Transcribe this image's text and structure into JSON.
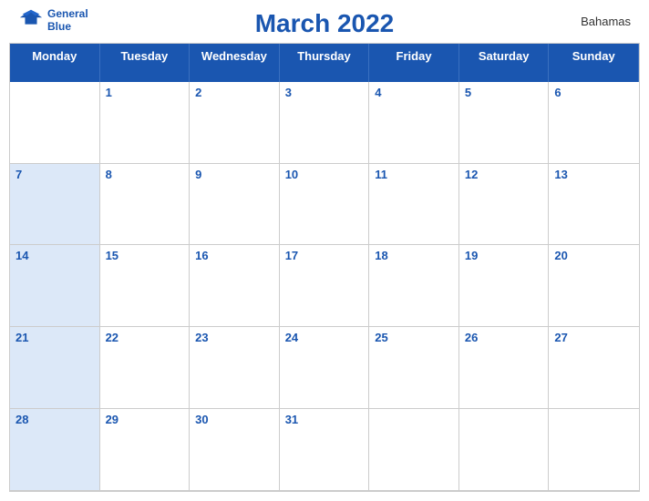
{
  "header": {
    "logo": {
      "line1": "General",
      "line2": "Blue"
    },
    "title": "March 2022",
    "country": "Bahamas"
  },
  "calendar": {
    "days_of_week": [
      "Monday",
      "Tuesday",
      "Wednesday",
      "Thursday",
      "Friday",
      "Saturday",
      "Sunday"
    ],
    "weeks": [
      [
        {
          "num": "",
          "empty": true
        },
        {
          "num": "1"
        },
        {
          "num": "2"
        },
        {
          "num": "3"
        },
        {
          "num": "4"
        },
        {
          "num": "5"
        },
        {
          "num": "6"
        }
      ],
      [
        {
          "num": "7"
        },
        {
          "num": "8"
        },
        {
          "num": "9"
        },
        {
          "num": "10"
        },
        {
          "num": "11"
        },
        {
          "num": "12"
        },
        {
          "num": "13"
        }
      ],
      [
        {
          "num": "14"
        },
        {
          "num": "15"
        },
        {
          "num": "16"
        },
        {
          "num": "17"
        },
        {
          "num": "18"
        },
        {
          "num": "19"
        },
        {
          "num": "20"
        }
      ],
      [
        {
          "num": "21"
        },
        {
          "num": "22"
        },
        {
          "num": "23"
        },
        {
          "num": "24"
        },
        {
          "num": "25"
        },
        {
          "num": "26"
        },
        {
          "num": "27"
        }
      ],
      [
        {
          "num": "28"
        },
        {
          "num": "29"
        },
        {
          "num": "30"
        },
        {
          "num": "31"
        },
        {
          "num": "",
          "empty": true
        },
        {
          "num": "",
          "empty": true
        },
        {
          "num": "",
          "empty": true
        }
      ]
    ]
  }
}
